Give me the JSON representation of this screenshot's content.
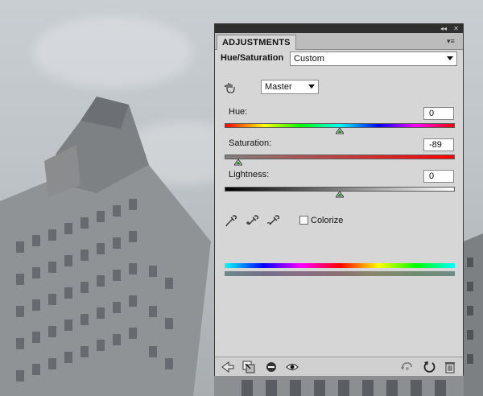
{
  "panel": {
    "tab_label": "ADJUSTMENTS",
    "collapse_glyph": "◂◂",
    "close_glyph": "✕",
    "menu_glyph": "▾≡",
    "title": "Hue/Saturation",
    "preset": {
      "selected": "Custom"
    },
    "channel": {
      "selected": "Master"
    },
    "hue": {
      "label": "Hue:",
      "value": "0"
    },
    "saturation": {
      "label": "Saturation:",
      "value": "-89"
    },
    "lightness": {
      "label": "Lightness:",
      "value": "0"
    },
    "colorize": {
      "label": "Colorize",
      "checked": false
    },
    "eyedroppers": [
      "eyedropper-icon",
      "eyedropper-plus-icon",
      "eyedropper-minus-icon"
    ],
    "footer_icons": [
      "back-arrow-icon",
      "clip-to-layer-icon",
      "visibility-layer-icon",
      "eye-icon",
      "view-previous-icon",
      "reset-icon",
      "trash-icon"
    ]
  }
}
